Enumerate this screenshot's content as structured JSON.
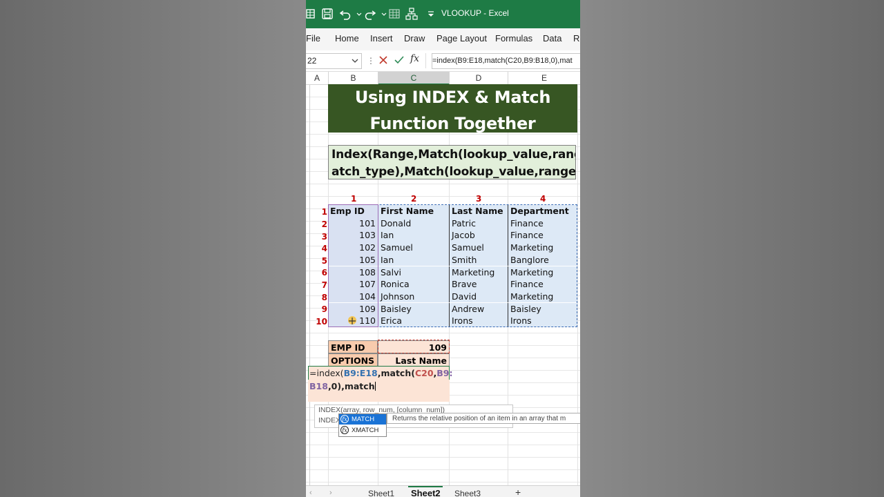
{
  "app": {
    "title": "VLOOKUP  -  Excel",
    "accent": "#1e7b45"
  },
  "ribbon_tabs": [
    "File",
    "Home",
    "Insert",
    "Draw",
    "Page Layout",
    "Formulas",
    "Data",
    "Re"
  ],
  "formula_bar": {
    "name_box": "22",
    "formula": "=index(B9:E18,match(C20,B9:B18,0),mat"
  },
  "column_headers": [
    "A",
    "B",
    "C",
    "D",
    "E"
  ],
  "title_lines": [
    "Using INDEX & Match",
    "Function Together"
  ],
  "syntax_lines": [
    "Index(Range,Match(lookup_value,range,m",
    "atch_type),Match(lookup_value,range,mat"
  ],
  "column_numbers": [
    "1",
    "2",
    "3",
    "4"
  ],
  "table": {
    "row_numbers": [
      "1",
      "2",
      "3",
      "4",
      "5",
      "6",
      "7",
      "8",
      "9",
      "10"
    ],
    "headers": [
      "Emp ID",
      "First Name",
      "Last Name",
      "Department"
    ],
    "rows": [
      [
        "101",
        "Donald",
        "Patric",
        "Finance"
      ],
      [
        "103",
        "Ian",
        "Jacob",
        "Finance"
      ],
      [
        "102",
        "Samuel",
        "Samuel",
        "Marketing"
      ],
      [
        "105",
        "Ian",
        "Smith",
        "Banglore"
      ],
      [
        "108",
        "Salvi",
        "Marketing",
        "Marketing"
      ],
      [
        "107",
        "Ronica",
        "Brave",
        "Finance"
      ],
      [
        "104",
        "Johnson",
        "David",
        "Marketing"
      ],
      [
        "109",
        "Baisley",
        "Andrew",
        "Baisley"
      ],
      [
        "110",
        "Erica",
        "Irons",
        "Irons"
      ]
    ]
  },
  "lookup": {
    "emp_label": "EMP ID",
    "emp_value": "109",
    "options_label": "OPTIONS",
    "options_value": "Last Name"
  },
  "edit_cell": {
    "p1": "=index(",
    "p2": "B9:E18",
    "p3": ",match(",
    "p4": "C20",
    "p5": ",",
    "p6": "B9:",
    "p7": "B18",
    "p8": ",0),match"
  },
  "tooltip": {
    "line1": "INDEX(array, row_num, [column_num])",
    "line2": "INDEX("
  },
  "autocomplete": {
    "items": [
      "MATCH",
      "XMATCH"
    ],
    "description": "Returns the relative position of an item in an array that m"
  },
  "sheet_tabs": [
    "Sheet1",
    "Sheet2",
    "Sheet3"
  ],
  "add_sheet": "+"
}
